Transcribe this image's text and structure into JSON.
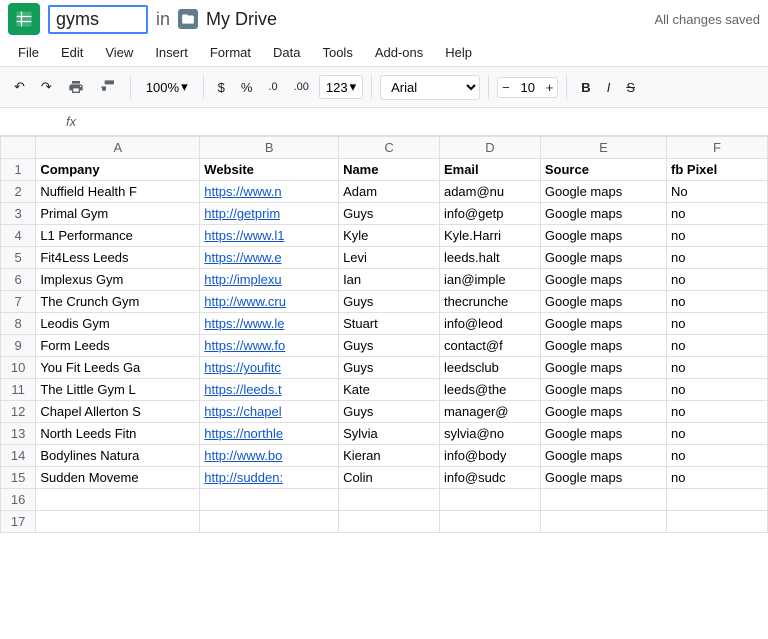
{
  "titleBar": {
    "docTitle": "gyms",
    "breadcrumbIn": "in",
    "myDriveLabel": "My Drive",
    "savedStatus": "All changes saved"
  },
  "menuBar": {
    "items": [
      "File",
      "Edit",
      "View",
      "Insert",
      "Format",
      "Data",
      "Tools",
      "Add-ons",
      "Help"
    ]
  },
  "toolbar": {
    "zoom": "100%",
    "currencySymbol": "$",
    "percentSymbol": "%",
    "decimalIncrease": ".0",
    "decimalFixed": ".00",
    "formatType": "123",
    "fontName": "Arial",
    "fontSize": "10",
    "boldLabel": "B",
    "italicLabel": "I",
    "strikeLabel": "S"
  },
  "formulaBar": {
    "cellRef": "",
    "fxLabel": "fx"
  },
  "columns": {
    "headers": [
      "",
      "A",
      "B",
      "C",
      "D",
      "E",
      "F"
    ],
    "labels": [
      "Company",
      "Website",
      "Name",
      "Email",
      "Source",
      "fb Pixel"
    ]
  },
  "rows": [
    {
      "num": "1",
      "a": "Company",
      "b": "Website",
      "c": "Name",
      "d": "Email",
      "e": "Source",
      "f": "fb Pixel",
      "isHeader": true
    },
    {
      "num": "2",
      "a": "Nuffield Health F",
      "b": "https://www.n",
      "c": "Adam",
      "d": "adam@nu",
      "e": "Google maps",
      "f": "No"
    },
    {
      "num": "3",
      "a": "Primal Gym",
      "b": "http://getprim",
      "c": "Guys",
      "d": "info@getp",
      "e": "Google maps",
      "f": "no"
    },
    {
      "num": "4",
      "a": "L1 Performance",
      "b": "https://www.l1",
      "c": "Kyle",
      "d": "Kyle.Harri",
      "e": "Google maps",
      "f": "no"
    },
    {
      "num": "5",
      "a": "Fit4Less Leeds",
      "b": "https://www.e",
      "c": "Levi",
      "d": "leeds.halt",
      "e": "Google maps",
      "f": "no"
    },
    {
      "num": "6",
      "a": "Implexus Gym",
      "b": "http://implexu",
      "c": "Ian",
      "d": "ian@imple",
      "e": "Google maps",
      "f": "no"
    },
    {
      "num": "7",
      "a": "The Crunch Gym",
      "b": "http://www.cru",
      "c": "Guys",
      "d": "thecrunche",
      "e": "Google maps",
      "f": "no"
    },
    {
      "num": "8",
      "a": "Leodis Gym",
      "b": "https://www.le",
      "c": "Stuart",
      "d": "info@leod",
      "e": "Google maps",
      "f": "no"
    },
    {
      "num": "9",
      "a": "Form Leeds",
      "b": "https://www.fo",
      "c": "Guys",
      "d": "contact@f",
      "e": "Google maps",
      "f": "no"
    },
    {
      "num": "10",
      "a": "You Fit Leeds Ga",
      "b": "https://youfitc",
      "c": "Guys",
      "d": "leedsclub",
      "e": "Google maps",
      "f": "no"
    },
    {
      "num": "11",
      "a": "The Little Gym L",
      "b": "https://leeds.t",
      "c": "Kate",
      "d": "leeds@the",
      "e": "Google maps",
      "f": "no"
    },
    {
      "num": "12",
      "a": "Chapel Allerton S",
      "b": "https://chapel",
      "c": "Guys",
      "d": "manager@",
      "e": "Google maps",
      "f": "no"
    },
    {
      "num": "13",
      "a": "North Leeds Fitn",
      "b": "https://northle",
      "c": "Sylvia",
      "d": "sylvia@no",
      "e": "Google maps",
      "f": "no"
    },
    {
      "num": "14",
      "a": "Bodylines Natura",
      "b": "http://www.bo",
      "c": "Kieran",
      "d": "info@body",
      "e": "Google maps",
      "f": "no"
    },
    {
      "num": "15",
      "a": "Sudden Moveme",
      "b": "http://sudden:",
      "c": "Colin",
      "d": "info@sudc",
      "e": "Google maps",
      "f": "no"
    },
    {
      "num": "16",
      "a": "",
      "b": "",
      "c": "",
      "d": "",
      "e": "",
      "f": ""
    },
    {
      "num": "17",
      "a": "",
      "b": "",
      "c": "",
      "d": "",
      "e": "",
      "f": ""
    }
  ]
}
